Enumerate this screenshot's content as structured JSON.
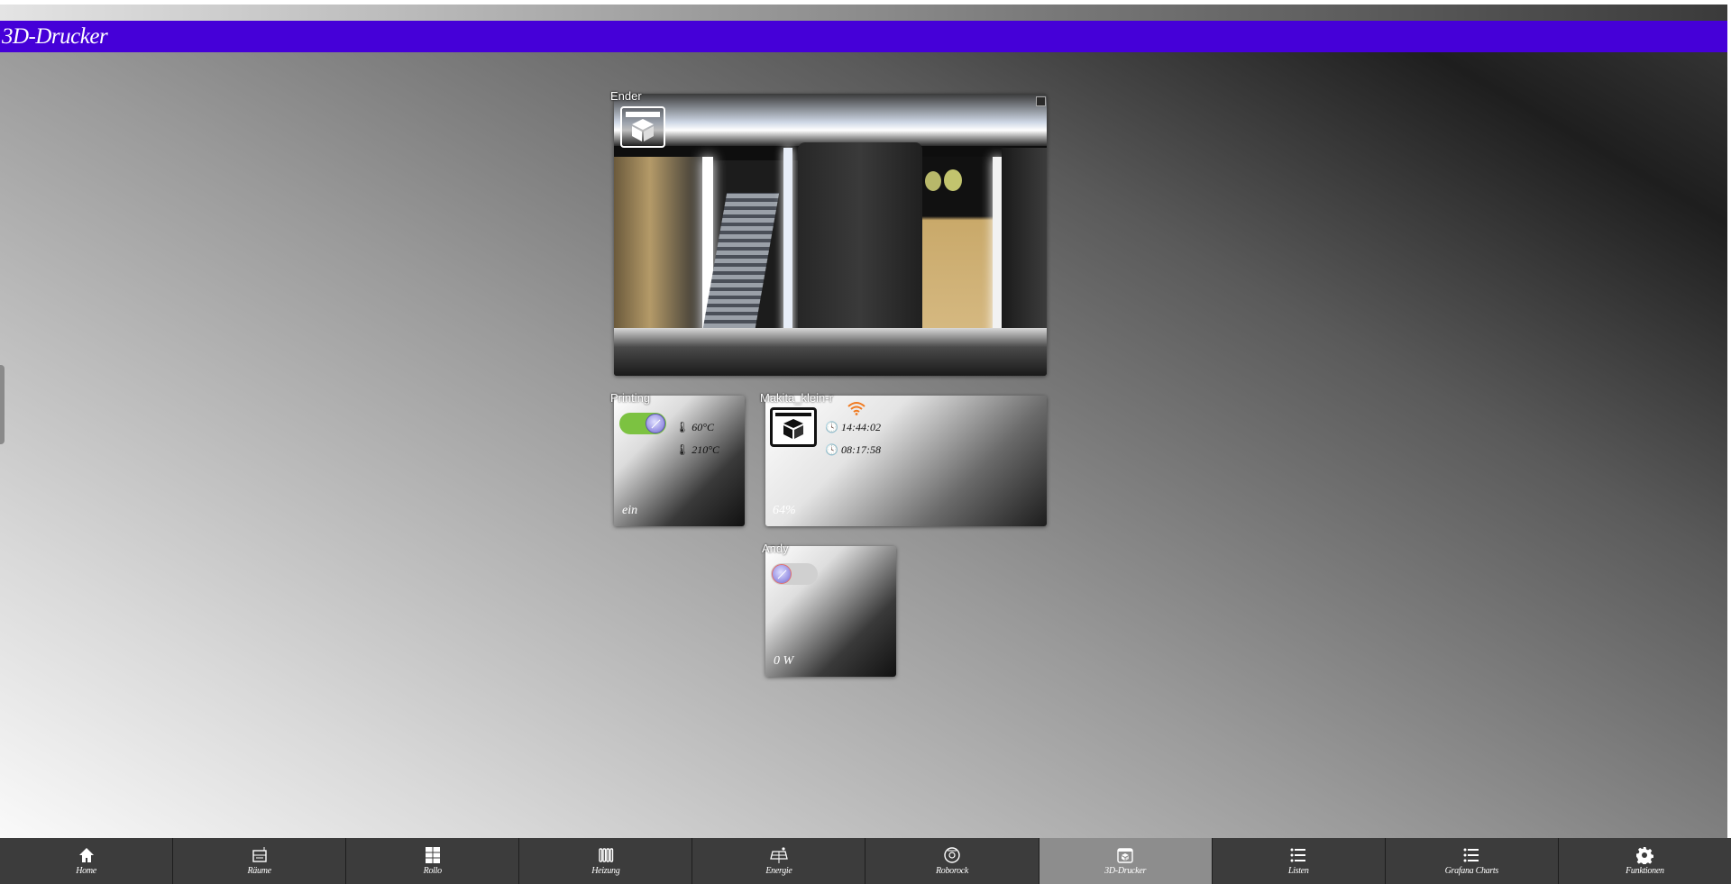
{
  "header": {
    "title": "3D-Drucker"
  },
  "camera": {
    "label": "Ender"
  },
  "printing": {
    "label": "Printing",
    "toggle_on": true,
    "bed_temp": "60°C",
    "nozzle_temp": "210°C",
    "state": "ein"
  },
  "makita": {
    "label": "Makita_klein-r",
    "time_elapsed": "14:44:02",
    "time_remaining": "08:17:58",
    "progress": "64%",
    "wifi_color": "#f07a20"
  },
  "andy": {
    "label": "Andy",
    "toggle_on": false,
    "power": "0 W"
  },
  "nav": {
    "items": [
      {
        "label": "Home",
        "icon": "home-icon"
      },
      {
        "label": "Räume",
        "icon": "room-icon"
      },
      {
        "label": "Rollo",
        "icon": "blinds-icon"
      },
      {
        "label": "Heizung",
        "icon": "radiator-icon"
      },
      {
        "label": "Energie",
        "icon": "solar-panel-icon"
      },
      {
        "label": "Roborock",
        "icon": "robot-vacuum-icon"
      },
      {
        "label": "3D-Drucker",
        "icon": "3d-printer-icon",
        "active": true
      },
      {
        "label": "Listen",
        "icon": "list-icon"
      },
      {
        "label": "Grafana Charts",
        "icon": "list-icon"
      },
      {
        "label": "Funktionen",
        "icon": "gear-icon"
      }
    ]
  },
  "colors": {
    "titlebar": "#4500d8",
    "toggle_on": "#7cc241",
    "nav_bg": "#3c3c3c",
    "nav_active": "#8d8d8d"
  }
}
